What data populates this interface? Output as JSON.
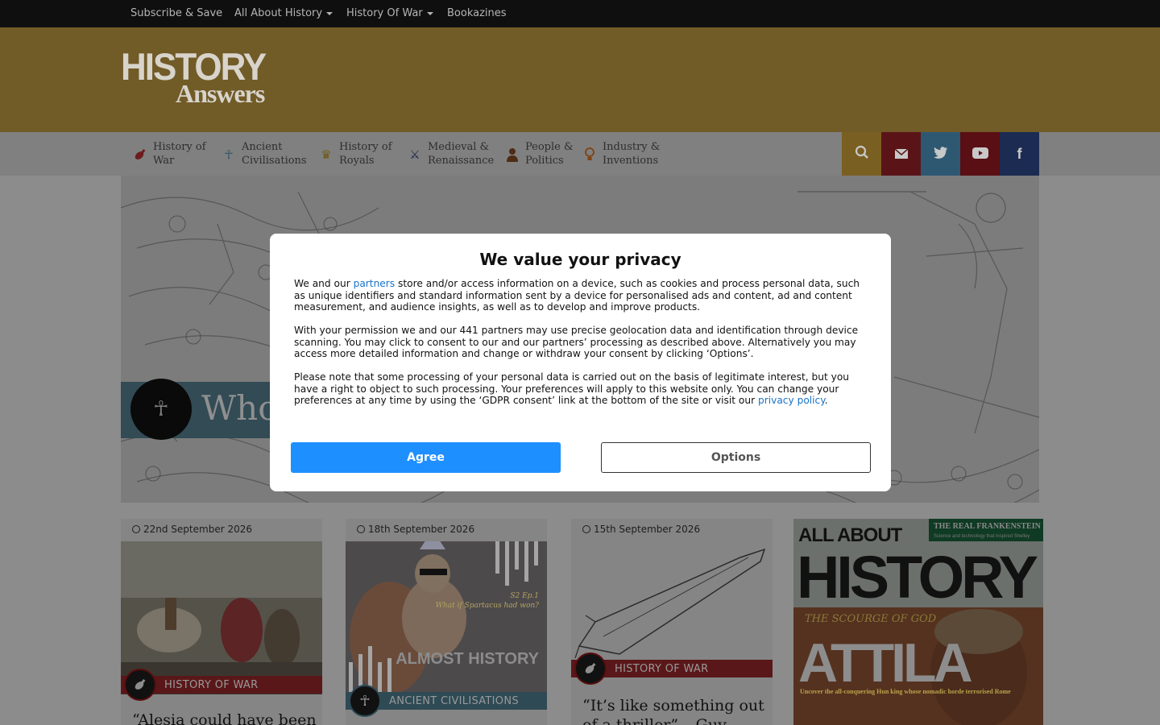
{
  "topbar": {
    "subscribe": "Subscribe & Save",
    "all_about_history": "All About History",
    "history_of_war": "History Of War",
    "bookazines": "Bookazines"
  },
  "logo": {
    "line1": "HISTORY",
    "line2": "Answers"
  },
  "nav": {
    "items": [
      {
        "label": "History of War",
        "icon": "bomb-icon",
        "color": "#a3262b"
      },
      {
        "label": "Ancient Civilisations",
        "icon": "ankh-icon",
        "color": "#2f6c82"
      },
      {
        "label": "History of Royals",
        "icon": "crown-icon",
        "color": "#9a7e1e"
      },
      {
        "label": "Medieval & Renaissance",
        "icon": "crossed-swords-icon",
        "color": "#1b2a5a"
      },
      {
        "label": "People & Politics",
        "icon": "person-icon",
        "color": "#6a3c1e"
      },
      {
        "label": "Industry & Inventions",
        "icon": "lightbulb-icon",
        "color": "#b25b18"
      }
    ],
    "social": [
      {
        "name": "search-icon",
        "color": "#7a5f22"
      },
      {
        "name": "mail-icon",
        "color": "#5a1417"
      },
      {
        "name": "twitter-icon",
        "color": "#2e5872"
      },
      {
        "name": "youtube-icon",
        "color": "#5a0f14"
      },
      {
        "name": "facebook-icon",
        "color": "#1c2b52"
      }
    ]
  },
  "hero": {
    "title": "Who"
  },
  "cards": [
    {
      "date": "22nd September 2026",
      "category": "HISTORY OF WAR",
      "headline": "“Alesia could have been"
    },
    {
      "date": "18th September 2026",
      "category": "ANCIENT CIVILISATIONS",
      "headline": ""
    },
    {
      "date": "15th September 2026",
      "category": "HISTORY OF WAR",
      "headline": "“It’s like something out of a thriller” – Guy"
    }
  ],
  "magazine": {
    "masthead_top": "ALL ABOUT",
    "masthead": "HISTORY",
    "corner_title": "THE REAL FRANKENSTEIN",
    "corner_sub": "Science and technology that inspired Shelley",
    "kicker": "THE SCOURGE OF GOD",
    "cover_title": "ATTILA",
    "cover_sub": "Uncover the all-conquering Hun king whose nomadic horde terrorised Rome"
  },
  "podcast": {
    "badge": "S2 Ep.1",
    "question": "What if Spartacus had won?",
    "brand": "ALMOST HISTORY"
  },
  "consent": {
    "title": "We value your privacy",
    "p1_pre": "We and our ",
    "p1_link": "partners",
    "p1_post": " store and/or access information on a device, such as cookies and process personal data, such as unique identifiers and standard information sent by a device for personalised ads and content, ad and content measurement, and audience insights, as well as to develop and improve products.",
    "p2": "With your permission we and our 441 partners may use precise geolocation data and identification through device scanning. You may click to consent to our and our partners’ processing as described above. Alternatively you may access more detailed information and change or withdraw your consent by clicking ‘Options’.",
    "p3_pre": "Please note that some processing of your personal data is carried out on the basis of legitimate interest, but you have a right to object to such processing. Your preferences will apply to this website only. You can change your preferences at any time by using the ‘GDPR consent’ link at the bottom of the site or visit our ",
    "p3_link": "privacy policy",
    "p3_post": ".",
    "agree": "Agree",
    "options": "Options"
  }
}
